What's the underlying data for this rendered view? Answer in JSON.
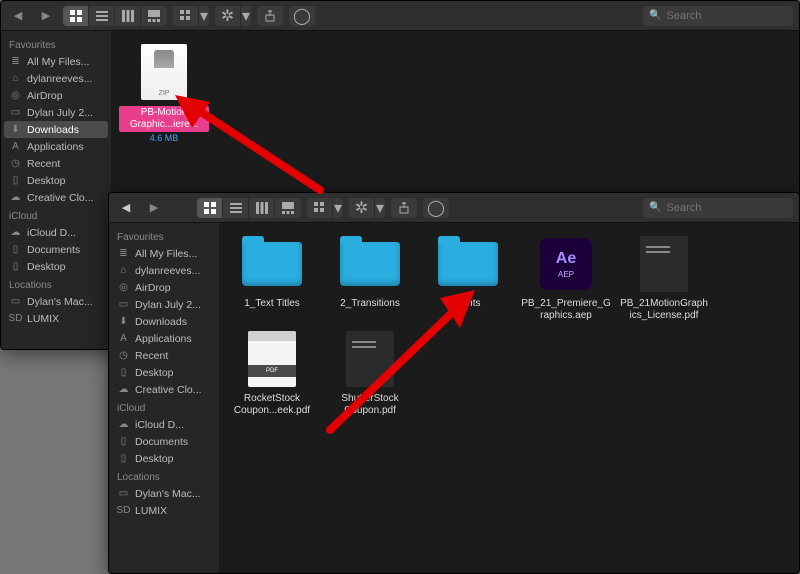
{
  "search_placeholder": "Search",
  "window1": {
    "sidebar": {
      "sections": [
        {
          "header": "Favourites",
          "items": [
            {
              "icon": "all-files",
              "label": "All My Files..."
            },
            {
              "icon": "home",
              "label": "dylanreeves..."
            },
            {
              "icon": "airdrop",
              "label": "AirDrop"
            },
            {
              "icon": "folder",
              "label": "Dylan July 2..."
            },
            {
              "icon": "download",
              "label": "Downloads",
              "active": true
            },
            {
              "icon": "apps",
              "label": "Applications"
            },
            {
              "icon": "clock",
              "label": "Recent"
            },
            {
              "icon": "desktop",
              "label": "Desktop"
            },
            {
              "icon": "cloud",
              "label": "Creative Clo..."
            }
          ]
        },
        {
          "header": "iCloud",
          "items": [
            {
              "icon": "cloud",
              "label": "iCloud D..."
            },
            {
              "icon": "doc",
              "label": "Documents"
            },
            {
              "icon": "desktop",
              "label": "Desktop"
            }
          ]
        },
        {
          "header": "Locations",
          "items": [
            {
              "icon": "monitor",
              "label": "Dylan's Mac..."
            },
            {
              "icon": "drive",
              "label": "LUMIX"
            }
          ]
        }
      ]
    },
    "files": [
      {
        "kind": "zip",
        "label": "PB-Motion Graphic...iere...",
        "sub": "4.6 MB",
        "selected": true
      }
    ]
  },
  "window2": {
    "sidebar": {
      "sections": [
        {
          "header": "Favourites",
          "items": [
            {
              "icon": "all-files",
              "label": "All My Files..."
            },
            {
              "icon": "home",
              "label": "dylanreeves..."
            },
            {
              "icon": "airdrop",
              "label": "AirDrop"
            },
            {
              "icon": "folder",
              "label": "Dylan July 2..."
            },
            {
              "icon": "download",
              "label": "Downloads"
            },
            {
              "icon": "apps",
              "label": "Applications"
            },
            {
              "icon": "clock",
              "label": "Recent"
            },
            {
              "icon": "desktop",
              "label": "Desktop"
            },
            {
              "icon": "cloud",
              "label": "Creative Clo..."
            }
          ]
        },
        {
          "header": "iCloud",
          "items": [
            {
              "icon": "cloud",
              "label": "iCloud D..."
            },
            {
              "icon": "doc",
              "label": "Documents"
            },
            {
              "icon": "desktop",
              "label": "Desktop"
            }
          ]
        },
        {
          "header": "Locations",
          "items": [
            {
              "icon": "monitor",
              "label": "Dylan's Mac..."
            },
            {
              "icon": "drive",
              "label": "LUMIX"
            }
          ]
        }
      ]
    },
    "files": [
      {
        "kind": "folder",
        "label": "1_Text Titles"
      },
      {
        "kind": "folder",
        "label": "2_Transitions"
      },
      {
        "kind": "folder",
        "label": "Fonts"
      },
      {
        "kind": "aep",
        "label": "PB_21_Premiere_Graphics.aep"
      },
      {
        "kind": "pdf-dark",
        "label": "PB_21MotionGraphics_License.pdf"
      },
      {
        "kind": "pdf",
        "label": "RocketStock Coupon...eek.pdf"
      },
      {
        "kind": "pdf-dark",
        "label": "ShutterStock Coupon.pdf"
      }
    ]
  },
  "icon_glyphs": {
    "all-files": "≣",
    "home": "⌂",
    "airdrop": "◎",
    "folder": "▭",
    "download": "⬇",
    "apps": "A",
    "clock": "◷",
    "desktop": "▯",
    "cloud": "☁",
    "doc": "▯",
    "monitor": "▭",
    "drive": "SD"
  }
}
